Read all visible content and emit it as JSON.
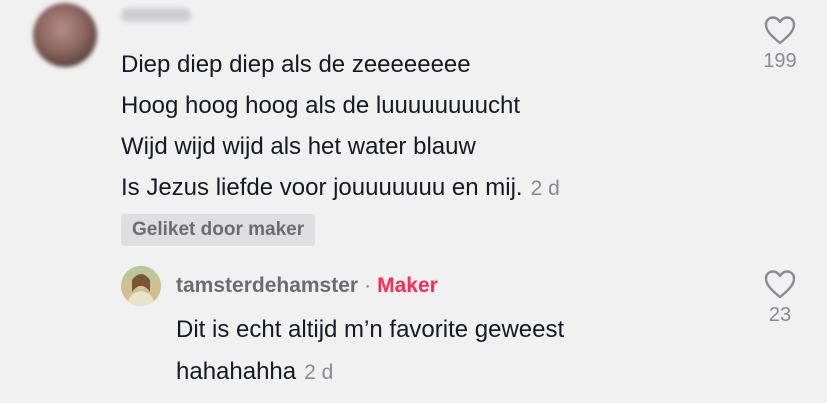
{
  "comment": {
    "lines": [
      "Diep diep diep als de zeeeeeeee",
      "Hoog hoog hoog als de luuuuuuuucht",
      "Wijd wijd wijd als het water blauw",
      "Is Jezus liefde voor jouuuuuuu en mij."
    ],
    "time": "2 d",
    "liked_badge": "Geliket door maker",
    "like_count": "199",
    "like_icon": "heart-outline-icon"
  },
  "reply": {
    "username": "tamsterdehamster",
    "separator": "·",
    "role_tag": "Maker",
    "lines": [
      "Dit is echt altijd m’n favorite geweest",
      "hahahahha"
    ],
    "time": "2 d",
    "like_count": "23",
    "like_icon": "heart-outline-icon"
  },
  "colors": {
    "background": "#f1f1f1",
    "text": "#161823",
    "muted": "#8a8b91",
    "maker": "#fe2c55",
    "badge_bg": "#dfdfe1"
  }
}
